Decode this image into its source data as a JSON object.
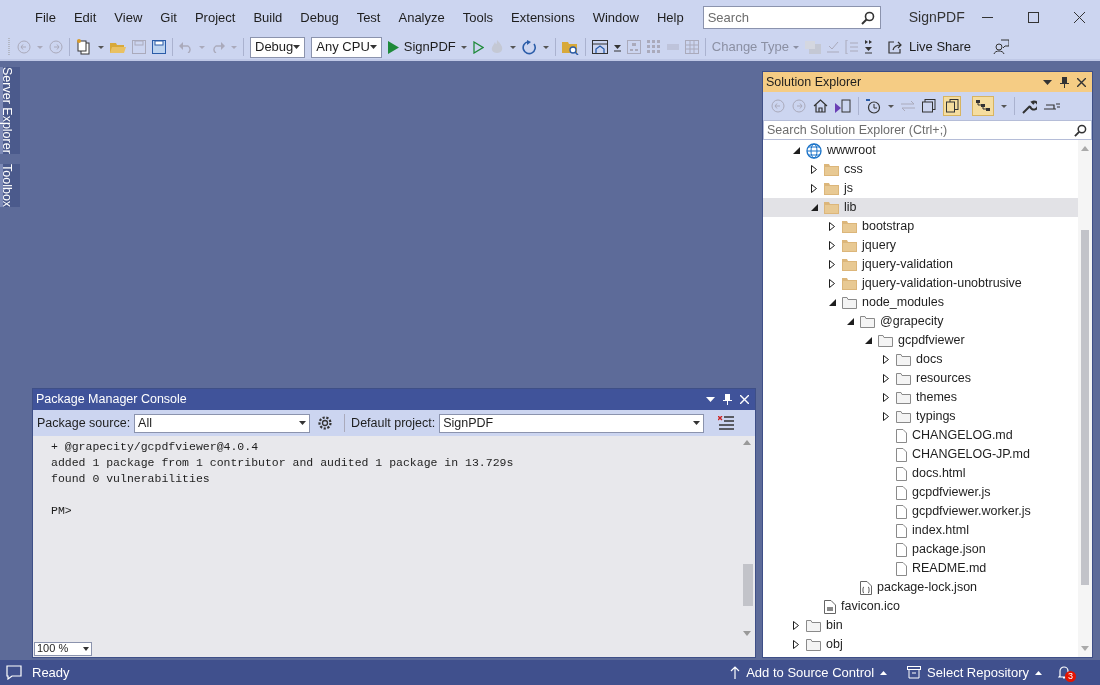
{
  "window": {
    "title": "SignPDF"
  },
  "menu": [
    "File",
    "Edit",
    "View",
    "Git",
    "Project",
    "Build",
    "Debug",
    "Test",
    "Analyze",
    "Tools",
    "Extensions",
    "Window",
    "Help"
  ],
  "search": {
    "placeholder": "Search"
  },
  "toolbar": {
    "configuration": "Debug",
    "platform": "Any CPU",
    "start_button": "SignPDF",
    "change_type": "Change Type",
    "live_share": "Live Share"
  },
  "side_tabs": [
    "Server Explorer",
    "Toolbox"
  ],
  "console": {
    "title": "Package Manager Console",
    "source_label": "Package source:",
    "source": "All",
    "project_label": "Default project:",
    "project": "SignPDF",
    "lines": [
      "+ @grapecity/gcpdfviewer@4.0.4",
      "added 1 package from 1 contributor and audited 1 package in 13.729s",
      "found 0 vulnerabilities"
    ],
    "prompt": "PM>",
    "zoom": "100 %"
  },
  "solution_explorer": {
    "title": "Solution Explorer",
    "search": {
      "placeholder": "Search Solution Explorer (Ctrl+;)"
    },
    "tree": [
      {
        "label": "wwwroot",
        "kind": "globe",
        "expanded": true,
        "selected": false,
        "children": [
          {
            "label": "css",
            "kind": "folder",
            "expanded": false,
            "selected": false
          },
          {
            "label": "js",
            "kind": "folder",
            "expanded": false,
            "selected": false
          },
          {
            "label": "lib",
            "kind": "folder",
            "expanded": true,
            "selected": true,
            "children": [
              {
                "label": "bootstrap",
                "kind": "folder",
                "expanded": false,
                "selected": false
              },
              {
                "label": "jquery",
                "kind": "folder",
                "expanded": false,
                "selected": false
              },
              {
                "label": "jquery-validation",
                "kind": "folder",
                "expanded": false,
                "selected": false
              },
              {
                "label": "jquery-validation-unobtrusive",
                "kind": "folder",
                "expanded": false,
                "selected": false
              },
              {
                "label": "node_modules",
                "kind": "hidden-folder",
                "expanded": true,
                "selected": false,
                "children": [
                  {
                    "label": "@grapecity",
                    "kind": "hidden-folder",
                    "expanded": true,
                    "selected": false,
                    "children": [
                      {
                        "label": "gcpdfviewer",
                        "kind": "hidden-folder",
                        "expanded": true,
                        "selected": false,
                        "children": [
                          {
                            "label": "docs",
                            "kind": "hidden-folder",
                            "expanded": false,
                            "selected": false
                          },
                          {
                            "label": "resources",
                            "kind": "hidden-folder",
                            "expanded": false,
                            "selected": false
                          },
                          {
                            "label": "themes",
                            "kind": "hidden-folder",
                            "expanded": false,
                            "selected": false
                          },
                          {
                            "label": "typings",
                            "kind": "hidden-folder",
                            "expanded": false,
                            "selected": false
                          },
                          {
                            "label": "CHANGELOG.md",
                            "kind": "hidden-file",
                            "selected": false
                          },
                          {
                            "label": "CHANGELOG-JP.md",
                            "kind": "hidden-file",
                            "selected": false
                          },
                          {
                            "label": "docs.html",
                            "kind": "hidden-file",
                            "selected": false
                          },
                          {
                            "label": "gcpdfviewer.js",
                            "kind": "hidden-file",
                            "selected": false
                          },
                          {
                            "label": "gcpdfviewer.worker.js",
                            "kind": "hidden-file",
                            "selected": false
                          },
                          {
                            "label": "index.html",
                            "kind": "hidden-file",
                            "selected": false
                          },
                          {
                            "label": "package.json",
                            "kind": "hidden-file",
                            "selected": false
                          },
                          {
                            "label": "README.md",
                            "kind": "hidden-file",
                            "selected": false
                          }
                        ]
                      }
                    ]
                  },
                  {
                    "label": "package-lock.json",
                    "kind": "json-file",
                    "selected": false
                  }
                ]
              }
            ]
          },
          {
            "label": "favicon.ico",
            "kind": "file",
            "selected": false
          }
        ]
      },
      {
        "label": "bin",
        "kind": "hidden-folder",
        "expanded": false,
        "selected": false
      },
      {
        "label": "obj",
        "kind": "hidden-folder",
        "expanded": false,
        "selected": false
      }
    ]
  },
  "status_bar": {
    "message": "Ready",
    "source_control": "Add to Source Control",
    "repository": "Select Repository",
    "notifications": "3"
  }
}
